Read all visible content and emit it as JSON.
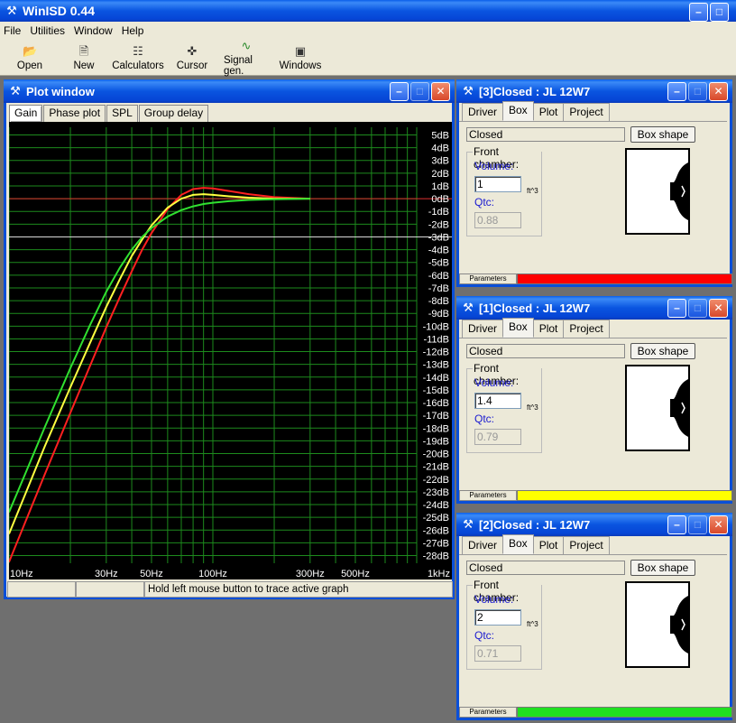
{
  "app": {
    "title": "WinISD 0.44"
  },
  "menu": [
    "File",
    "Utilities",
    "Window",
    "Help"
  ],
  "toolbar": [
    {
      "label": "Open",
      "icon": "folder-open-icon"
    },
    {
      "label": "New",
      "icon": "new-document-icon"
    },
    {
      "label": "Calculators",
      "icon": "calculator-sliders-icon"
    },
    {
      "label": "Cursor",
      "icon": "crosshair-icon"
    },
    {
      "label": "Signal gen.",
      "icon": "sine-wave-icon"
    },
    {
      "label": "Windows",
      "icon": "window-icon"
    }
  ],
  "plot_window": {
    "title": "Plot window",
    "tabs": [
      "Gain",
      "Phase plot",
      "SPL",
      "Group delay"
    ],
    "active_tab": "Gain",
    "status": [
      "",
      "",
      "Hold left mouse button to trace active graph"
    ]
  },
  "chart_data": {
    "type": "line",
    "xscale": "log",
    "xlim": [
      10,
      1000
    ],
    "ylim": [
      -28.6,
      5.6
    ],
    "y_ticks": [
      5,
      4,
      3,
      2,
      1,
      0,
      -1,
      -2,
      -3,
      -4,
      -5,
      -6,
      -7,
      -8,
      -9,
      -10,
      -11,
      -12,
      -13,
      -14,
      -15,
      -16,
      -17,
      -18,
      -19,
      -20,
      -21,
      -22,
      -23,
      -24,
      -25,
      -26,
      -27,
      -28
    ],
    "y_tick_labels": [
      "5dB",
      "4dB",
      "3dB",
      "2dB",
      "1dB",
      "0dB",
      "-1dB",
      "-2dB",
      "-3dB",
      "-4dB",
      "-5dB",
      "-6dB",
      "-7dB",
      "-8dB",
      "-9dB",
      "-10dB",
      "-11dB",
      "-12dB",
      "-13dB",
      "-14dB",
      "-15dB",
      "-16dB",
      "-17dB",
      "-18dB",
      "-19dB",
      "-20dB",
      "-21dB",
      "-22dB",
      "-23dB",
      "-24dB",
      "-25dB",
      "-26dB",
      "-27dB",
      "-28dB"
    ],
    "x_ticks": [
      10,
      30,
      50,
      100,
      300,
      500,
      1000
    ],
    "x_tick_labels": [
      "10Hz",
      "30Hz",
      "50Hz",
      "100Hz",
      "300Hz",
      "500Hz",
      "1kHz"
    ],
    "reference_lines": [
      {
        "y": 0,
        "color": "#e03030"
      },
      {
        "y": -3,
        "color": "#d8d8d8"
      }
    ],
    "grid": true,
    "series": [
      {
        "color": "#ff2020",
        "x": [
          10,
          12,
          15,
          20,
          25,
          30,
          35,
          40,
          45,
          50,
          60,
          70,
          80,
          90,
          100,
          120,
          150,
          200,
          300
        ],
        "y": [
          -28.5,
          -25.4,
          -21.6,
          -16.8,
          -13.1,
          -10.1,
          -7.7,
          -5.7,
          -4.0,
          -2.7,
          -0.8,
          0.3,
          0.75,
          0.85,
          0.8,
          0.6,
          0.35,
          0.12,
          0.0
        ]
      },
      {
        "color": "#ffff40",
        "x": [
          10,
          12,
          15,
          20,
          25,
          30,
          35,
          40,
          45,
          50,
          60,
          70,
          80,
          90,
          100,
          120,
          150,
          200,
          300
        ],
        "y": [
          -26.3,
          -23.2,
          -19.4,
          -14.8,
          -11.3,
          -8.5,
          -6.3,
          -4.5,
          -3.2,
          -2.1,
          -0.7,
          0.0,
          0.3,
          0.35,
          0.3,
          0.18,
          0.08,
          0.0,
          0.0
        ]
      },
      {
        "color": "#30e030",
        "x": [
          10,
          12,
          15,
          20,
          25,
          30,
          35,
          40,
          45,
          50,
          60,
          70,
          80,
          90,
          100,
          120,
          150,
          200,
          300
        ],
        "y": [
          -24.6,
          -21.6,
          -17.9,
          -13.3,
          -9.9,
          -7.3,
          -5.4,
          -4.0,
          -3.0,
          -2.3,
          -1.4,
          -0.9,
          -0.6,
          -0.42,
          -0.32,
          -0.2,
          -0.1,
          -0.05,
          0.0
        ]
      }
    ]
  },
  "design_windows": [
    {
      "title": "[3]Closed : JL 12W7",
      "tabs": [
        "Driver",
        "Box",
        "Plot",
        "Project"
      ],
      "active_tab": "Box",
      "box_type": "Closed",
      "box_shape_label": "Box shape",
      "front_chamber_label": "Front chamber:",
      "volume_label": "Volume:",
      "volume": "1",
      "unit": "ft^3",
      "qtc_label": "Qtc:",
      "qtc": "0.88",
      "parameters_label": "Parameters",
      "color": "#ff0000"
    },
    {
      "title": "[1]Closed : JL 12W7",
      "tabs": [
        "Driver",
        "Box",
        "Plot",
        "Project"
      ],
      "active_tab": "Box",
      "box_type": "Closed",
      "box_shape_label": "Box shape",
      "front_chamber_label": "Front chamber:",
      "volume_label": "Volume:",
      "volume": "1.4",
      "unit": "ft^3",
      "qtc_label": "Qtc:",
      "qtc": "0.79",
      "parameters_label": "Parameters",
      "color": "#ffff00"
    },
    {
      "title": "[2]Closed : JL 12W7",
      "tabs": [
        "Driver",
        "Box",
        "Plot",
        "Project"
      ],
      "active_tab": "Box",
      "box_type": "Closed",
      "box_shape_label": "Box shape",
      "front_chamber_label": "Front chamber:",
      "volume_label": "Volume:",
      "volume": "2",
      "unit": "ft^3",
      "qtc_label": "Qtc:",
      "qtc": "0.71",
      "parameters_label": "Parameters",
      "color": "#20e020"
    }
  ]
}
